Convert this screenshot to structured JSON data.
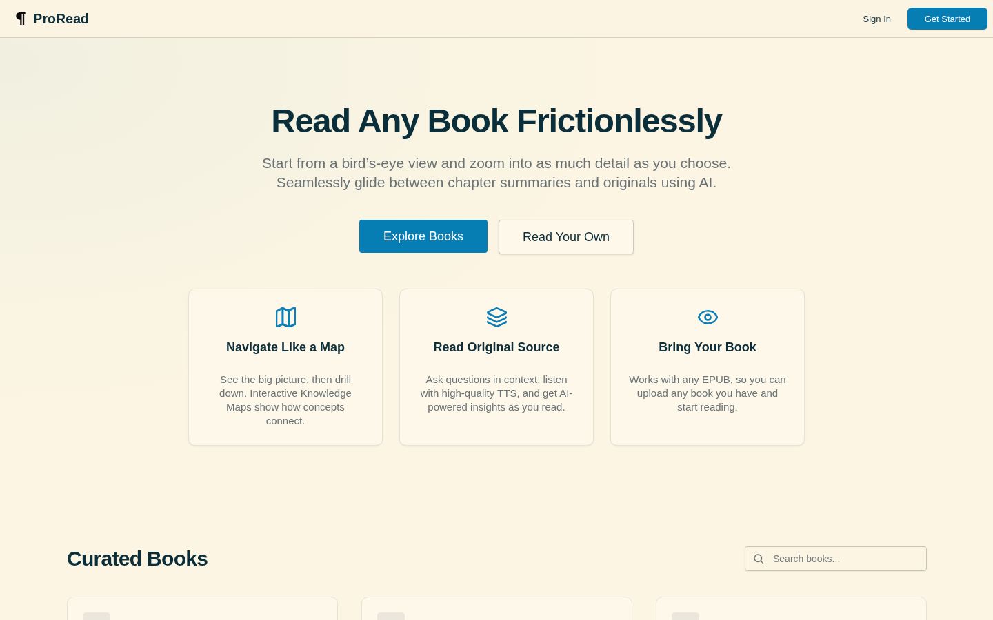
{
  "header": {
    "brand": "ProRead",
    "sign_in": "Sign In",
    "cta": "Get Started"
  },
  "hero": {
    "title": "Read Any Book Frictionlessly",
    "subtitle_lines": [
      "Start from a bird’s-eye view and zoom into as much detail as you choose.",
      "Seamlessly glide between chapter summaries and originals using AI."
    ],
    "buttons": [
      {
        "label": "Explore Books",
        "kind": "primary"
      },
      {
        "label": "Read Your Own",
        "kind": "secondary"
      }
    ]
  },
  "features": [
    {
      "title": "Navigate Like a Map",
      "text": "See the big picture, then drill down. Interactive Knowledge Maps show how concepts connect."
    },
    {
      "title": "Read Original Source",
      "text": "Ask questions in context, listen with high-quality TTS, and get AI-powered insights as you read."
    },
    {
      "title": "Bring Your Book",
      "text": "Works with any EPUB, so you can upload any book you have and start reading."
    }
  ],
  "curated": {
    "title": "Curated Books",
    "search": {
      "placeholder": "Search books..."
    }
  }
}
